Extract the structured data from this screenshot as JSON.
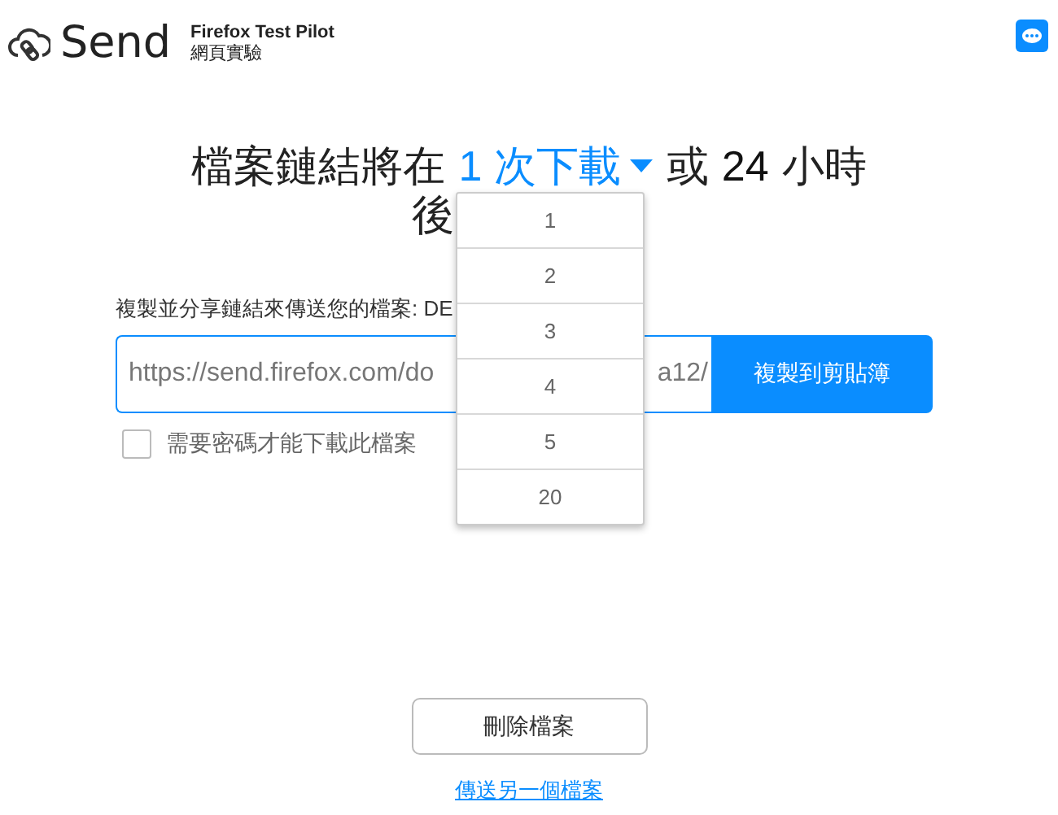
{
  "header": {
    "brand": "Send",
    "product": "Firefox Test Pilot",
    "subtitle": "網頁實驗"
  },
  "heading": {
    "before": "檔案鏈結將在",
    "downloads": "1 次下載",
    "middle": "或",
    "hours": "24",
    "after": "小時",
    "line2": "後"
  },
  "dropdown": {
    "options": [
      {
        "label": "1",
        "selected": false
      },
      {
        "label": "2",
        "selected": false
      },
      {
        "label": "3",
        "selected": false
      },
      {
        "label": "4",
        "selected": false
      },
      {
        "label": "5",
        "selected": false
      },
      {
        "label": "20",
        "selected": false
      }
    ]
  },
  "share": {
    "label": "複製並分享鏈結來傳送您的檔案: DE",
    "url_start": "https://send.firefox.com/do",
    "url_end": "a12/",
    "copy_button": "複製到剪貼簿"
  },
  "password": {
    "label": "需要密碼才能下載此檔案",
    "checked": false
  },
  "delete_button": "刪除檔案",
  "another_link": "傳送另一個檔案"
}
